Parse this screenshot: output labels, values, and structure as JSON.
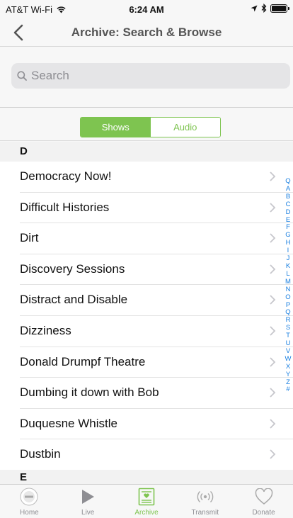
{
  "status_bar": {
    "carrier": "AT&T Wi-Fi",
    "time": "6:24 AM"
  },
  "nav": {
    "title": "Archive: Search & Browse"
  },
  "search": {
    "placeholder": "Search"
  },
  "segments": {
    "shows": "Shows",
    "audio": "Audio"
  },
  "sections": [
    {
      "letter": "D",
      "items": [
        "Democracy Now!",
        "Difficult Histories",
        "Dirt",
        "Discovery Sessions",
        "Distract and Disable",
        "Dizziness",
        "Donald Drumpf Theatre",
        "Dumbing it down with Bob",
        "Duquesne Whistle",
        "Dustbin"
      ]
    },
    {
      "letter": "E",
      "items": []
    }
  ],
  "index_letters": [
    "Q",
    "A",
    "B",
    "C",
    "D",
    "E",
    "F",
    "G",
    "H",
    "I",
    "J",
    "K",
    "L",
    "M",
    "N",
    "O",
    "P",
    "Q",
    "R",
    "S",
    "T",
    "U",
    "V",
    "W",
    "X",
    "Y",
    "Z",
    "#"
  ],
  "tabs": [
    {
      "label": "Home",
      "icon": "station-logo-icon",
      "active": false
    },
    {
      "label": "Live",
      "icon": "play-icon",
      "active": false
    },
    {
      "label": "Archive",
      "icon": "archive-icon",
      "active": true
    },
    {
      "label": "Transmit",
      "icon": "broadcast-icon",
      "active": false
    },
    {
      "label": "Donate",
      "icon": "heart-icon",
      "active": false
    }
  ],
  "colors": {
    "accent": "#7ec450",
    "index": "#1a7fe0"
  }
}
